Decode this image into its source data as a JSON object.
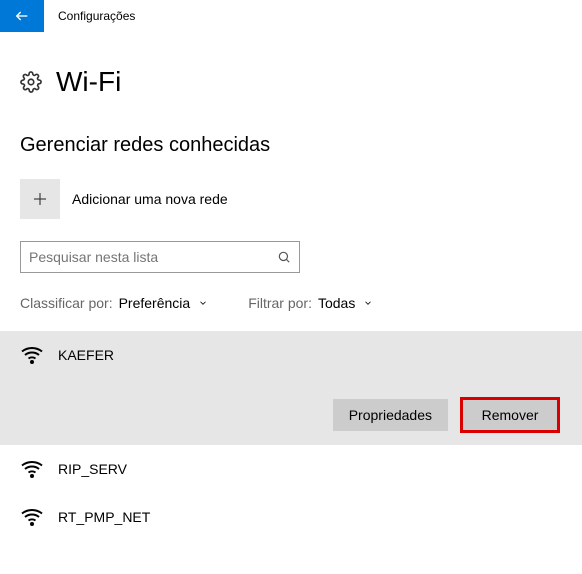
{
  "window": {
    "title": "Configurações"
  },
  "page": {
    "title": "Wi-Fi",
    "section_title": "Gerenciar redes conhecidas"
  },
  "add": {
    "label": "Adicionar uma nova rede"
  },
  "search": {
    "placeholder": "Pesquisar nesta lista"
  },
  "sort": {
    "label": "Classificar por:",
    "value": "Preferência"
  },
  "filter": {
    "label": "Filtrar por:",
    "value": "Todas"
  },
  "networks": [
    {
      "name": "KAEFER",
      "selected": true
    },
    {
      "name": "RIP_SERV",
      "selected": false
    },
    {
      "name": "RT_PMP_NET",
      "selected": false
    }
  ],
  "actions": {
    "properties": "Propriedades",
    "remove": "Remover"
  },
  "icons": {
    "back": "back-arrow-icon",
    "gear": "gear-icon",
    "plus": "plus-icon",
    "search": "search-icon",
    "chevron": "chevron-down-icon",
    "wifi": "wifi-icon"
  }
}
